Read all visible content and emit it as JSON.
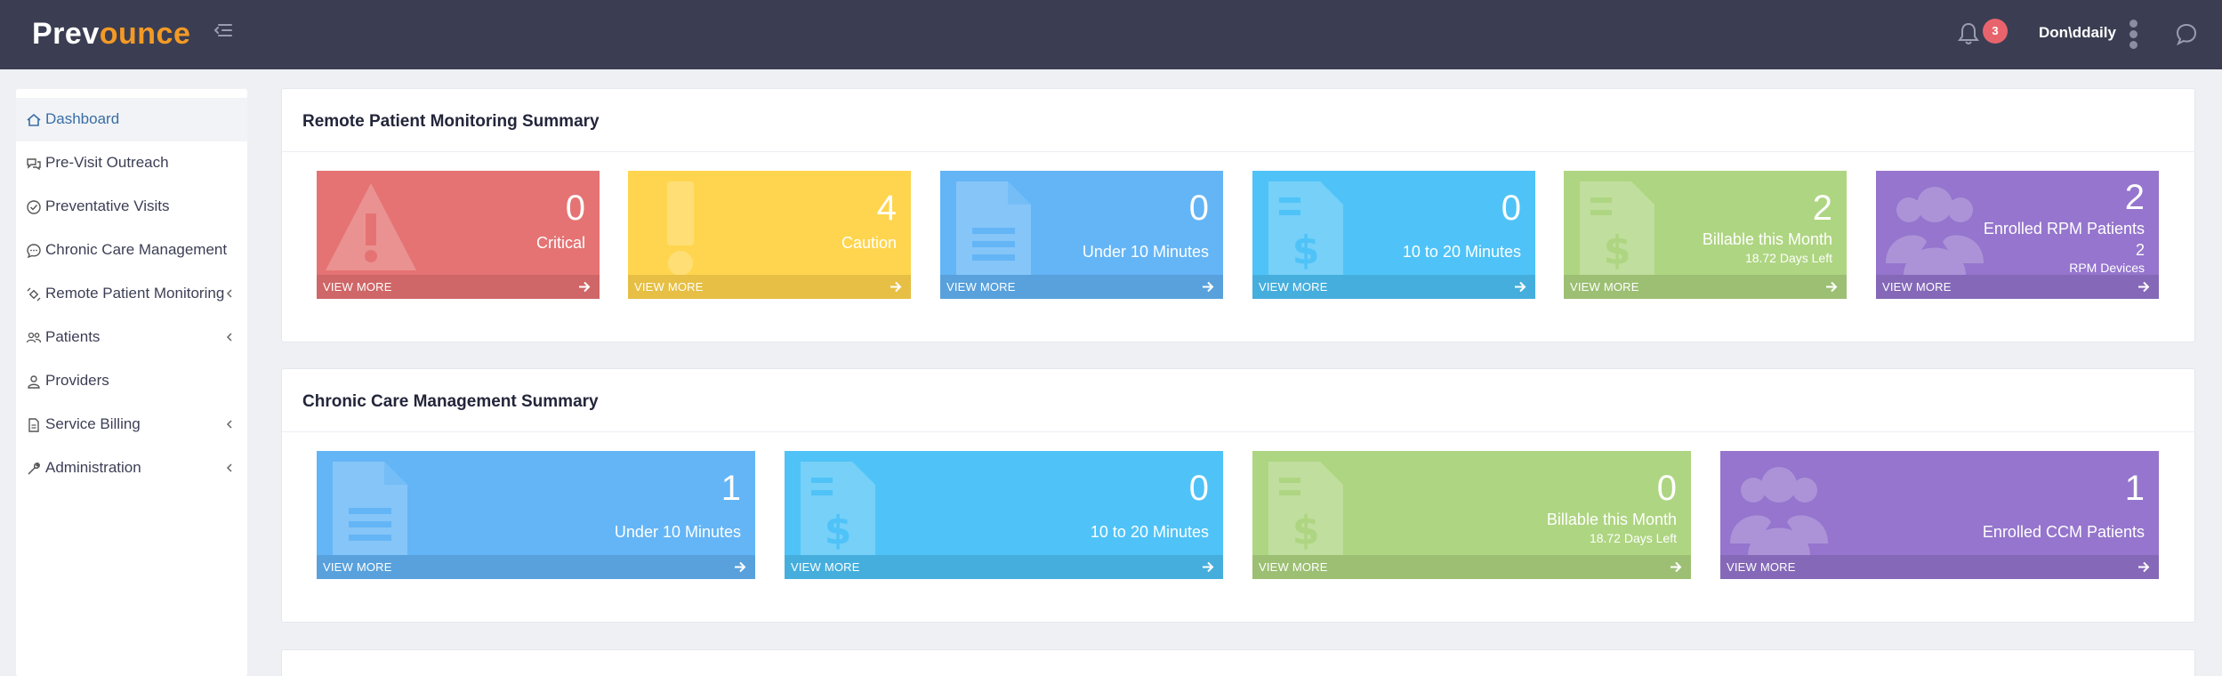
{
  "header": {
    "logo_part1": "Prev",
    "logo_part2": "ounce",
    "notification_count": "3",
    "username": "Don\\ddaily",
    "icons": [
      "collapse-menu-icon",
      "bell-icon",
      "kebab-menu-icon",
      "chat-icon"
    ]
  },
  "sidebar": {
    "items": [
      {
        "label": "Dashboard",
        "icon": "home-icon",
        "active": true
      },
      {
        "label": "Pre-Visit Outreach",
        "icon": "chat-bubbles-icon"
      },
      {
        "label": "Preventative Visits",
        "icon": "check-circle-icon"
      },
      {
        "label": "Chronic Care Management",
        "icon": "message-icon"
      },
      {
        "label": "Remote Patient Monitoring",
        "icon": "satellite-icon",
        "expandable": true
      },
      {
        "label": "Patients",
        "icon": "users-icon",
        "expandable": true
      },
      {
        "label": "Providers",
        "icon": "user-icon"
      },
      {
        "label": "Service Billing",
        "icon": "invoice-icon",
        "expandable": true
      },
      {
        "label": "Administration",
        "icon": "wrench-icon",
        "expandable": true
      }
    ]
  },
  "rpm_summary": {
    "title": "Remote Patient Monitoring Summary",
    "cards": [
      {
        "value": "0",
        "label": "Critical",
        "footer": "VIEW MORE",
        "color": "#e57373",
        "icon": "warning-icon"
      },
      {
        "value": "4",
        "label": "Caution",
        "footer": "VIEW MORE",
        "color": "#ffd54f",
        "icon": "exclamation-icon"
      },
      {
        "value": "0",
        "label": "Under 10 Minutes",
        "footer": "VIEW MORE",
        "color": "#64b5f6",
        "icon": "document-icon"
      },
      {
        "value": "0",
        "label": "10 to 20 Minutes",
        "footer": "VIEW MORE",
        "color": "#4fc3f7",
        "icon": "invoice-dollar-icon"
      },
      {
        "value": "2",
        "label": "Billable this Month",
        "sub": "18.72 Days Left",
        "footer": "VIEW MORE",
        "color": "#aed581",
        "icon": "invoice-dollar-icon"
      },
      {
        "value": "2",
        "label": "Enrolled RPM Patients",
        "sub_value": "2",
        "sub": "RPM Devices",
        "footer": "VIEW MORE",
        "color": "#9575cd",
        "icon": "users-icon"
      }
    ]
  },
  "ccm_summary": {
    "title": "Chronic Care Management Summary",
    "cards": [
      {
        "value": "1",
        "label": "Under 10 Minutes",
        "footer": "VIEW MORE",
        "color": "#64b5f6",
        "icon": "document-icon"
      },
      {
        "value": "0",
        "label": "10 to 20 Minutes",
        "footer": "VIEW MORE",
        "color": "#4fc3f7",
        "icon": "invoice-dollar-icon"
      },
      {
        "value": "0",
        "label": "Billable this Month",
        "sub": "18.72 Days Left",
        "footer": "VIEW MORE",
        "color": "#aed581",
        "icon": "invoice-dollar-icon"
      },
      {
        "value": "1",
        "label": "Enrolled CCM Patients",
        "footer": "VIEW MORE",
        "color": "#9575cd",
        "icon": "users-icon"
      }
    ]
  }
}
